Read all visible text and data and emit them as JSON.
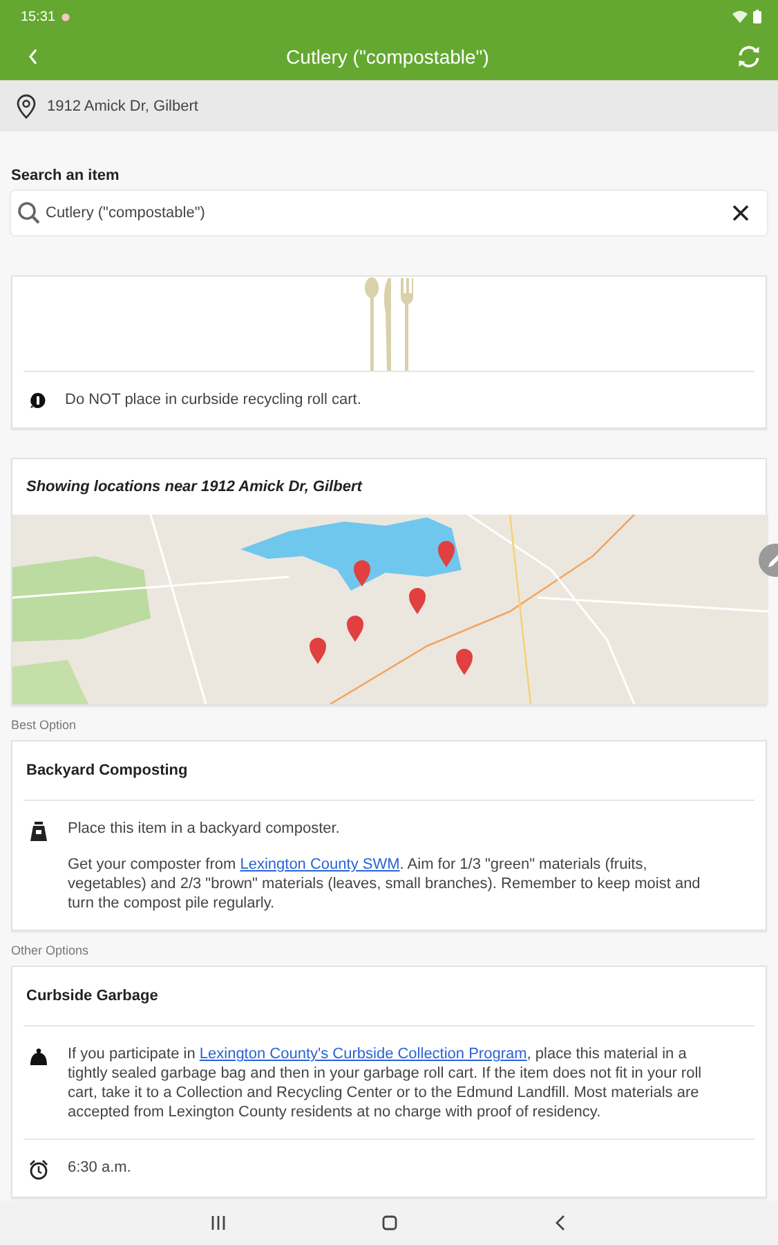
{
  "status_bar": {
    "time": "15:31"
  },
  "app_bar": {
    "title": "Cutlery (\"compostable\")"
  },
  "location": {
    "address": "1912 Amick Dr, Gilbert"
  },
  "search": {
    "label": "Search an item",
    "value": "Cutlery (\"compostable\")"
  },
  "item": {
    "notice": "Do NOT place in curbside recycling roll cart."
  },
  "map": {
    "heading": "Showing locations near 1912 Amick Dr, Gilbert"
  },
  "sections": [
    {
      "label": "Best Option",
      "cards": [
        {
          "title": "Backyard Composting",
          "entries": [
            {
              "kind": "composter",
              "paragraphs": [
                {
                  "text": "Place this item in a backyard composter."
                },
                {
                  "before": "Get your composter from ",
                  "link": "Lexington County SWM",
                  "after": ". Aim for 1/3 \"green\" materials (fruits, vegetables) and 2/3 \"brown\" materials (leaves, small branches). Remember to keep moist and turn the compost pile regularly."
                }
              ]
            }
          ]
        }
      ]
    },
    {
      "label": "Other Options",
      "cards": [
        {
          "title": "Curbside Garbage",
          "entries": [
            {
              "kind": "bag",
              "paragraphs": [
                {
                  "before": "If you participate in ",
                  "link": "Lexington County's Curbside Collection Program",
                  "after": ", place this material in a tightly sealed garbage bag and then in your garbage roll cart.  If the item does not fit in your roll cart, take it to a Collection and Recycling Center or to the Edmund Landfill. Most materials are accepted from Lexington County residents at no charge with proof of residency."
                }
              ]
            },
            {
              "kind": "clock",
              "paragraphs": [
                {
                  "text": "6:30 a.m."
                }
              ]
            }
          ]
        }
      ]
    }
  ]
}
